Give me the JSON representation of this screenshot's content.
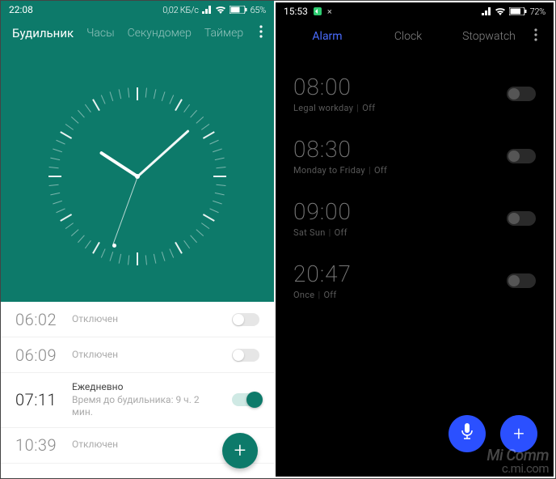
{
  "left": {
    "status": {
      "time": "22:08",
      "net_speed": "0,02 КБ/с",
      "battery": "65%"
    },
    "tabs": {
      "alarm": "Будильник",
      "clock": "Часы",
      "stopwatch": "Секундомер",
      "timer": "Таймер"
    },
    "clock": {
      "hour_angle": 303,
      "minute_angle": 48,
      "second_angle": 200
    },
    "alarms": [
      {
        "time": "06:02",
        "label": "Отключен",
        "sub": "",
        "on": false
      },
      {
        "time": "06:09",
        "label": "Отключен",
        "sub": "",
        "on": false
      },
      {
        "time": "07:11",
        "label": "Ежедневно",
        "sub": "Время до будильника: 9 ч. 2 мин.",
        "on": true
      },
      {
        "time": "10:39",
        "label": "Отключен",
        "sub": "",
        "on": false
      }
    ],
    "fab_icon": "+"
  },
  "right": {
    "status": {
      "time": "15:53",
      "battery": "72%"
    },
    "tabs": {
      "alarm": "Alarm",
      "clock": "Clock",
      "stopwatch": "Stopwatch"
    },
    "alarms": [
      {
        "time": "08:00",
        "label": "Legal workday",
        "state": "Off",
        "on": false
      },
      {
        "time": "08:30",
        "label": "Monday to Friday",
        "state": "Off",
        "on": false
      },
      {
        "time": "09:00",
        "label": "Sat Sun",
        "state": "Off",
        "on": false
      },
      {
        "time": "20:47",
        "label": "Once",
        "state": "Off",
        "on": false
      }
    ],
    "fab_plus": "+",
    "watermark_top": "Mi Comm",
    "watermark_bot": "c.mi.com"
  }
}
